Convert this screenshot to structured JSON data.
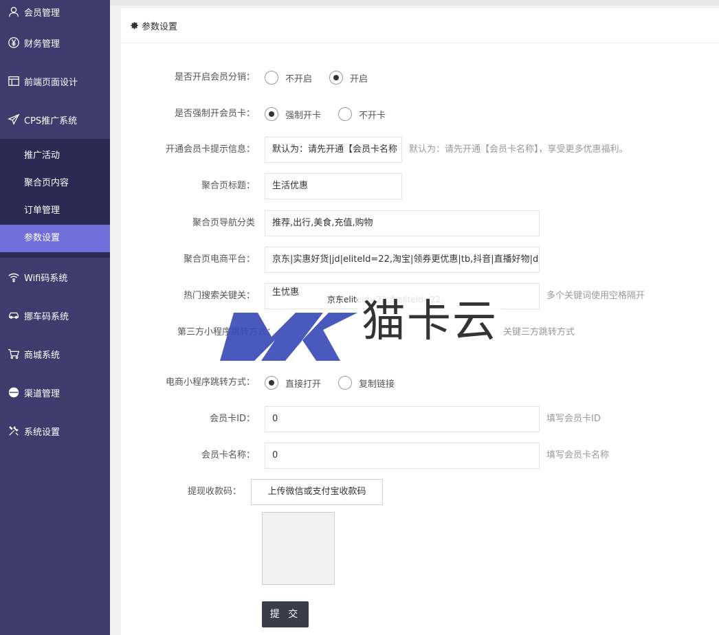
{
  "sidebar": {
    "top_item": {
      "label": "会员管理",
      "icon": "user-icon"
    },
    "items": [
      {
        "label": "财务管理",
        "icon": "yen-icon"
      },
      {
        "label": "前端页面设计",
        "icon": "layout-icon"
      },
      {
        "label": "CPS推广系统",
        "icon": "send-icon"
      }
    ],
    "submenu": [
      {
        "label": "推广活动"
      },
      {
        "label": "聚合页内容"
      },
      {
        "label": "订单管理"
      },
      {
        "label": "参数设置",
        "active": true
      }
    ],
    "items_after": [
      {
        "label": "Wifi码系统",
        "icon": "wifi-icon"
      },
      {
        "label": "挪车码系统",
        "icon": "car-icon"
      },
      {
        "label": "商城系统",
        "icon": "cart-icon"
      },
      {
        "label": "渠道管理",
        "icon": "circle-icon"
      },
      {
        "label": "系统设置",
        "icon": "tools-icon"
      }
    ]
  },
  "panel": {
    "title": "参数设置"
  },
  "form": {
    "member_dist": {
      "label": "是否开启会员分销：",
      "options": [
        "不开启",
        "开启"
      ],
      "selected": "开启"
    },
    "force_card": {
      "label": "是否强制开会员卡：",
      "options": [
        "强制开卡",
        "不开卡"
      ],
      "selected": "强制开卡"
    },
    "card_tip": {
      "label": "开通会员卡提示信息：",
      "value": "默认为：请先开通【会员卡名称",
      "hint": "默认为：请先开通【会员卡名称】，享受更多优惠福利。"
    },
    "agg_title": {
      "label": "聚合页标题：",
      "value": "生活优惠"
    },
    "agg_nav": {
      "label": "聚合页导航分类",
      "value": "推荐,出行,美食,充值,购物"
    },
    "agg_platform": {
      "label": "聚合页电商平台：",
      "value": "京东|实惠好货|jd|eliteId=22,淘宝|领券更优惠|tb,抖音|直播好物|d"
    },
    "hot_keywords": {
      "label": "热门搜索关键关：",
      "value": "生忧惠",
      "value2": "京东eliteId=22,淘eliteId=22,",
      "hint": "多个关键词使用空格隔开"
    },
    "third_party": {
      "label": "第三方小程序跳转方式：",
      "hint": "关键三方跳转方式"
    },
    "ecom_jump": {
      "label": "电商小程序跳转方式：",
      "options": [
        "直接打开",
        "复制链接"
      ],
      "selected": "直接打开"
    },
    "card_id": {
      "label": "会员卡ID：",
      "value": "0",
      "hint": "填写会员卡ID"
    },
    "card_name": {
      "label": "会员卡名称：",
      "value": "0",
      "hint": "填写会员卡名称"
    },
    "withdraw_code": {
      "label": "提现收款码：",
      "button": "上传微信或支付宝收款码"
    },
    "submit": "提 交"
  },
  "watermark": {
    "text": "猫卡云",
    "logo_text": "MK"
  },
  "colors": {
    "sidebar_bg": "#3d3c6c",
    "submenu_bg": "#2b2a53",
    "active_bg": "#6f6edb",
    "submit_bg": "#393d49"
  }
}
